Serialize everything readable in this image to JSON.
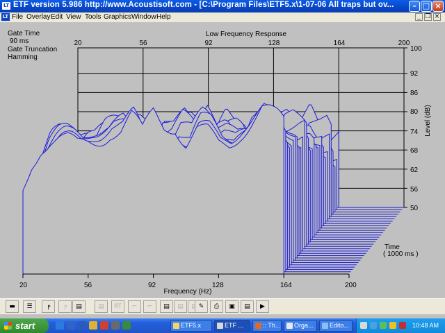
{
  "window": {
    "title": "ETF version 5.986 http://www.Acoustisoft.com - [C:\\Program Files\\ETF5.x\\1-07-06 All traps but ov...",
    "app_icon_text": "LT",
    "min_icon": "minimize-icon",
    "max_icon": "maximize-icon",
    "close_icon": "close-icon"
  },
  "menu": {
    "mdi_icon_text": "LT",
    "items": [
      "File",
      "Overlay",
      "Edit",
      "View",
      "Tools",
      "Graphics",
      "Window",
      "Help"
    ]
  },
  "plot": {
    "info": {
      "gate_time_label": "Gate Time",
      "gate_time_value": "90 ms",
      "window_label": "Gate Truncation",
      "window_value": "Hamming"
    },
    "title": "Low Frequency Response",
    "top_ticks": [
      "20",
      "56",
      "92",
      "128",
      "164",
      "200"
    ],
    "level_ticks": [
      "100",
      "92",
      "86",
      "80",
      "74",
      "68",
      "62",
      "56",
      "50"
    ],
    "level_label": "Level (dB)",
    "bottom_ticks": [
      "20",
      "56",
      "92",
      "128",
      "164",
      "200"
    ],
    "freq_label": "Frequency (Hz)",
    "time_label": "Time",
    "time_value": "( 1000 ms )",
    "line_color": "#1a1adc",
    "background": "#c0c0c0"
  },
  "chart_data": {
    "type": "line",
    "title": "Low Frequency Response",
    "xlabel": "Frequency (Hz)",
    "ylabel": "Level (dB)",
    "zlabel": "Time ( 1000 ms )",
    "xlim": [
      20,
      200
    ],
    "ylim": [
      50,
      100
    ],
    "x_ticks": [
      20,
      56,
      92,
      128,
      164,
      200
    ],
    "y_ticks": [
      50,
      56,
      62,
      68,
      74,
      80,
      86,
      92,
      100
    ],
    "slices": 30,
    "front_slice_x": [
      20,
      25,
      30,
      35,
      40,
      45,
      50,
      56,
      62,
      68,
      74,
      80,
      86,
      92,
      98,
      104,
      110,
      116,
      122,
      128,
      134,
      140,
      146,
      152,
      158,
      164
    ],
    "front_slice_y": [
      74,
      84,
      90,
      92,
      93,
      93,
      92,
      94,
      95,
      96,
      94,
      96,
      90,
      98,
      96,
      98,
      93,
      97,
      96,
      92,
      92,
      95,
      97,
      99,
      96,
      94
    ],
    "color": "#1a1adc"
  },
  "toolbar": {
    "buttons": [
      {
        "name": "zoom-out-button",
        "glyph": "▬",
        "enabled": true
      },
      {
        "name": "tile-button",
        "glyph": "☰",
        "enabled": true
      },
      {
        "name": "impulse-button",
        "glyph": "╒",
        "enabled": true
      },
      {
        "name": "frequency-button",
        "glyph": "╒",
        "enabled": false
      },
      {
        "name": "waterfall-button",
        "glyph": "▤",
        "enabled": true
      },
      {
        "name": "waterfall-alt-button",
        "glyph": "▤",
        "enabled": false
      },
      {
        "name": "rt60-button",
        "glyph": "RT",
        "enabled": false
      },
      {
        "name": "step-button",
        "glyph": "⌐",
        "enabled": false
      },
      {
        "name": "energy-button",
        "glyph": "⌐",
        "enabled": false
      },
      {
        "name": "spectrum-button",
        "glyph": "▤",
        "enabled": true
      },
      {
        "name": "cumulative-button",
        "glyph": "▤",
        "enabled": false
      },
      {
        "name": "phase-button",
        "glyph": "▤",
        "enabled": false
      },
      {
        "name": "edit-button",
        "glyph": "✎",
        "enabled": true
      },
      {
        "name": "print-button",
        "glyph": "⎙",
        "enabled": true
      },
      {
        "name": "copy-button",
        "glyph": "▣",
        "enabled": true
      },
      {
        "name": "paste-button",
        "glyph": "▤",
        "enabled": true
      },
      {
        "name": "play-button",
        "glyph": "▶",
        "enabled": true
      }
    ]
  },
  "taskbar": {
    "start_label": "start",
    "quick_launch": [
      {
        "name": "ie-icon",
        "color": "#2a7ae2"
      },
      {
        "name": "outlook-icon",
        "color": "#2f64c4"
      },
      {
        "name": "word-icon",
        "color": "#2b5bb8"
      },
      {
        "name": "explorer-icon",
        "color": "#e0b030"
      },
      {
        "name": "media-icon",
        "color": "#d04030"
      },
      {
        "name": "cd-icon",
        "color": "#6a6a6a"
      },
      {
        "name": "app-icon",
        "color": "#3a8a3a"
      }
    ],
    "tasks": [
      "ETF5.x",
      "ETF ...",
      ":: Th...",
      "Orga...",
      "Edito...",
      ""
    ],
    "clock": "10:48 AM",
    "tray_icons": [
      "network-icon",
      "volume-icon",
      "sync-icon",
      "antivirus-icon",
      "security-icon"
    ]
  }
}
